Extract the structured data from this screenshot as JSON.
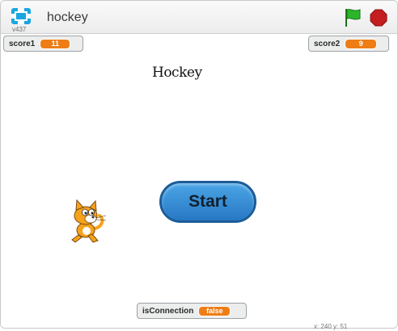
{
  "project": {
    "title": "hockey",
    "version": "v437"
  },
  "controls": {
    "fullscreen_icon": "fullscreen-icon",
    "green_flag_icon": "green-flag-icon",
    "stop_icon": "stop-sign-icon",
    "flag_color": "#2cb52b",
    "stop_color": "#c41e1e"
  },
  "watchers": {
    "score1": {
      "label": "score1",
      "value": "11"
    },
    "score2": {
      "label": "score2",
      "value": "9"
    },
    "isConnection": {
      "label": "isConnection",
      "value": "false"
    }
  },
  "stage": {
    "heading": "Hockey",
    "start_button": "Start",
    "sprite": "scratch-cat"
  },
  "readout": "x: 240  y: 51",
  "colors": {
    "watcher_value": "#ee7d16",
    "start_button": "#3a8fd6"
  }
}
